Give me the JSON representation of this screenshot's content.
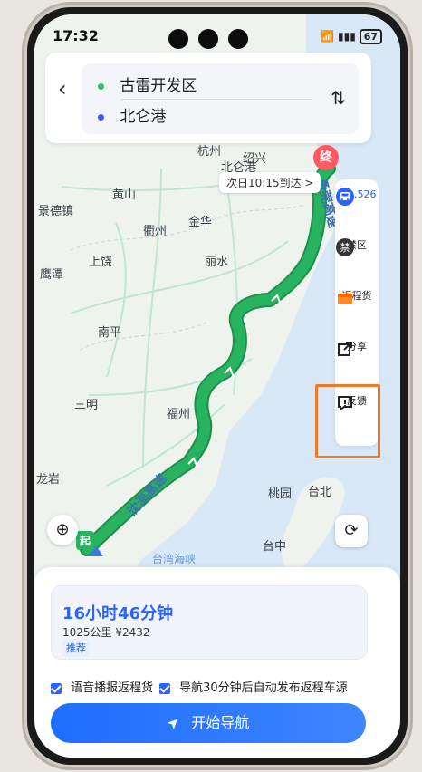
{
  "status_bar": {
    "time": "17:32",
    "battery": "67"
  },
  "route": {
    "origin": "古雷开发区",
    "destination": "北仑港"
  },
  "eta": {
    "text": "次日10:15到达 >"
  },
  "markers": {
    "start": "起",
    "end": "终"
  },
  "map": {
    "places": [
      "杭州",
      "绍兴",
      "北仑港",
      "黄山",
      "景德镇",
      "衢州",
      "金华",
      "鹰潭",
      "上饶",
      "丽水",
      "南平",
      "三明",
      "福州",
      "龙岩",
      "桃园",
      "台北",
      "台中"
    ],
    "route_labels": [
      "甬莞高速",
      "沈海高速"
    ],
    "sea_labels": [
      "台湾海峡"
    ]
  },
  "tools": [
    {
      "label": "湘…526",
      "icon": "bus-icon"
    },
    {
      "label": "禁区",
      "icon": "ban-icon"
    },
    {
      "label": "返程货",
      "icon": "box-icon"
    },
    {
      "label": "分享",
      "icon": "share-icon"
    },
    {
      "label": "反馈",
      "icon": "feedback-icon"
    }
  ],
  "summary": {
    "duration": "16小时46分钟",
    "distance_price": "1025公里  ¥2432",
    "tag": "推荐"
  },
  "options": [
    {
      "label": "语音播报返程货",
      "checked": true
    },
    {
      "label": "导航30分钟后自动发布返程车源",
      "checked": true
    }
  ],
  "start_button": {
    "label": "开始导航"
  },
  "colors": {
    "accent": "#2b63ff",
    "route": "#27b35f",
    "highlight": "#f07a2b"
  }
}
